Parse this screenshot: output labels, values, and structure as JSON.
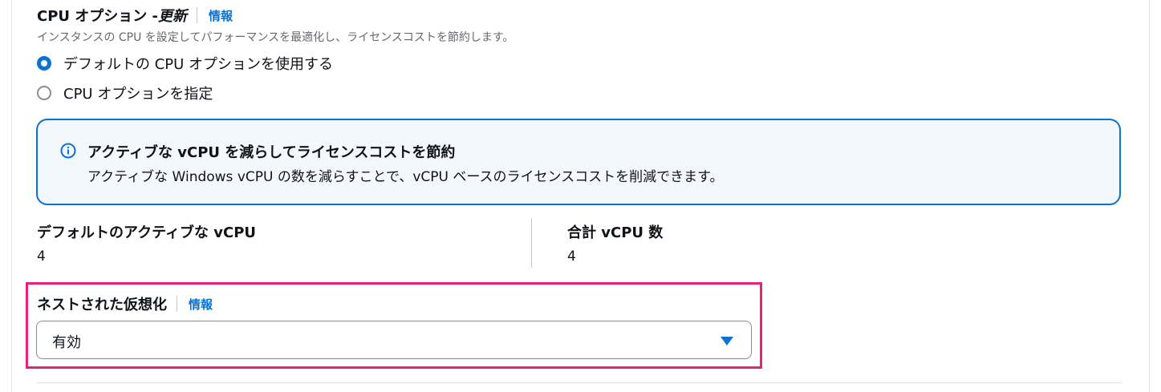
{
  "cpu_options": {
    "title": "CPU オプション - ",
    "title_emphasis": "更新",
    "info_label": "情報",
    "description": "インスタンスの CPU を設定してパフォーマンスを最適化し、ライセンスコストを節約します。",
    "options": [
      {
        "label": "デフォルトの CPU オプションを使用する",
        "selected": true
      },
      {
        "label": "CPU オプションを指定",
        "selected": false
      }
    ]
  },
  "alert": {
    "icon": "info-icon",
    "title": "アクティブな vCPU を減らしてライセンスコストを節約",
    "body": "アクティブな Windows vCPU の数を減らすことで、vCPU ベースのライセンスコストを削減できます。",
    "accent_color": "#0972d3",
    "background_color": "#f2f8fd"
  },
  "details": {
    "default_active_vcpu": {
      "label": "デフォルトのアクティブな vCPU",
      "value": "4"
    },
    "total_vcpu": {
      "label": "合計 vCPU 数",
      "value": "4"
    }
  },
  "nested_virtualization": {
    "title": "ネストされた仮想化",
    "info_label": "情報",
    "selected_value": "有効",
    "highlight_color": "#e8217a"
  }
}
